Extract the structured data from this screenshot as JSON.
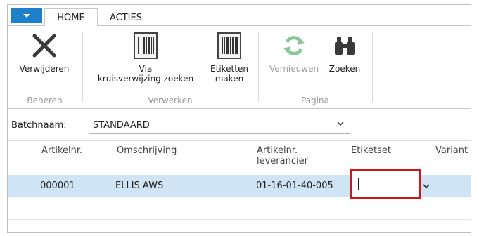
{
  "tabs": {
    "home": "HOME",
    "acties": "ACTIES"
  },
  "ribbon": {
    "beheren": {
      "label": "Beheren",
      "verwijderen": "Verwijderen"
    },
    "verwerken": {
      "label": "Verwerken",
      "via_line1": "Via",
      "via_line2": "kruisverwijzing zoeken",
      "etiketten_line1": "Etiketten",
      "etiketten_line2": "maken"
    },
    "pagina": {
      "label": "Pagina",
      "vernieuwen": "Vernieuwen",
      "zoeken": "Zoeken"
    }
  },
  "batch": {
    "label": "Batchnaam:",
    "value": "STANDAARD"
  },
  "grid": {
    "columns": {
      "artikelnr": "Artikelnr.",
      "omschrijving": "Omschrijving",
      "lev_line1": "Artikelnr.",
      "lev_line2": "leverancier",
      "etiketset": "Etiketset",
      "variant": "Variant"
    },
    "rows": [
      {
        "artikelnr": "000001",
        "omschrijving": "ELLIS AWS",
        "leverancier": "01-16-01-40-005",
        "etiketset": ""
      }
    ]
  },
  "colors": {
    "accent": "#1e7fcb",
    "selected_row": "#cfe5f6",
    "highlight": "#d2151d"
  }
}
